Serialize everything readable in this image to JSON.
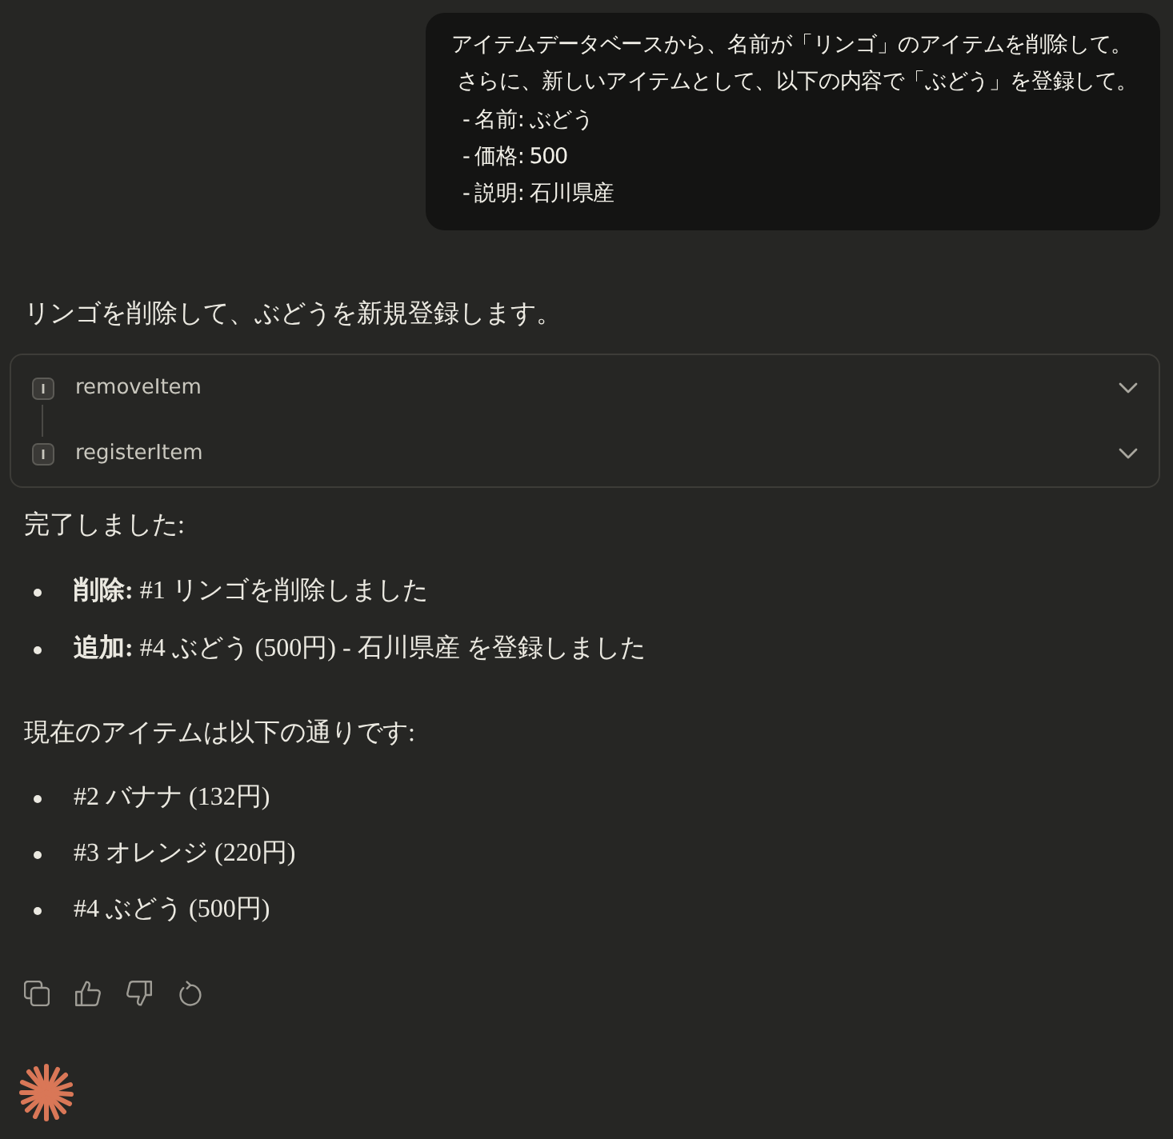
{
  "user_message": {
    "lines": [
      "アイテムデータベースから、名前が「リンゴ」のアイテムを削除して。",
      " さらに、新しいアイテムとして、以下の内容で「ぶどう」を登録して。",
      "  - 名前: ぶどう",
      "  - 価格: 500",
      "  - 説明: 石川県産"
    ]
  },
  "response": {
    "intro": "リンゴを削除して、ぶどうを新規登録します。",
    "tool_calls": [
      {
        "name": "removeItem",
        "expanded": false
      },
      {
        "name": "registerItem",
        "expanded": false
      }
    ],
    "completion": "完了しました:",
    "summary": [
      "**削除:** #1 リンゴを削除しました",
      "**追加:** #4 ぶどう (500円) - 石川県産 を登録しました"
    ],
    "current_label": "現在のアイテムは以下の通りです:",
    "items": [
      "#2 バナナ (132円)",
      "#3 オレンジ (220円)",
      "#4 ぶどう (500円)"
    ]
  }
}
